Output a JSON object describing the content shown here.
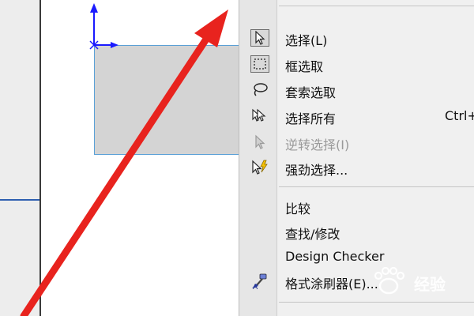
{
  "menu": {
    "items": [
      {
        "label": "选择(L)",
        "icon": "arrow-cursor-icon",
        "enabled": true
      },
      {
        "label": "框选取",
        "icon": "box-select-icon",
        "enabled": true
      },
      {
        "label": "套索选取",
        "icon": "lasso-icon",
        "enabled": true
      },
      {
        "label": "选择所有",
        "icon": "select-all-icon",
        "enabled": true,
        "shortcut": "Ctrl+"
      },
      {
        "label": "逆转选择(I)",
        "icon": "invert-selection-icon",
        "enabled": false
      },
      {
        "label": "强劲选择...",
        "icon": "power-select-icon",
        "enabled": true
      },
      {
        "label": "比较",
        "enabled": true
      },
      {
        "label": "查找/修改",
        "enabled": true
      },
      {
        "label": "Design Checker",
        "enabled": true
      },
      {
        "label": "格式涂刷器(E)...",
        "icon": "format-painter-icon",
        "enabled": true
      }
    ]
  },
  "watermark": {
    "text": "经验"
  },
  "colors": {
    "annotation_arrow": "#e8231e",
    "sketch_fill": "#d4d4d4",
    "sketch_edge": "#5aa0d6",
    "axis": "#1a1aff",
    "menu_bg": "#f0f0f0"
  }
}
